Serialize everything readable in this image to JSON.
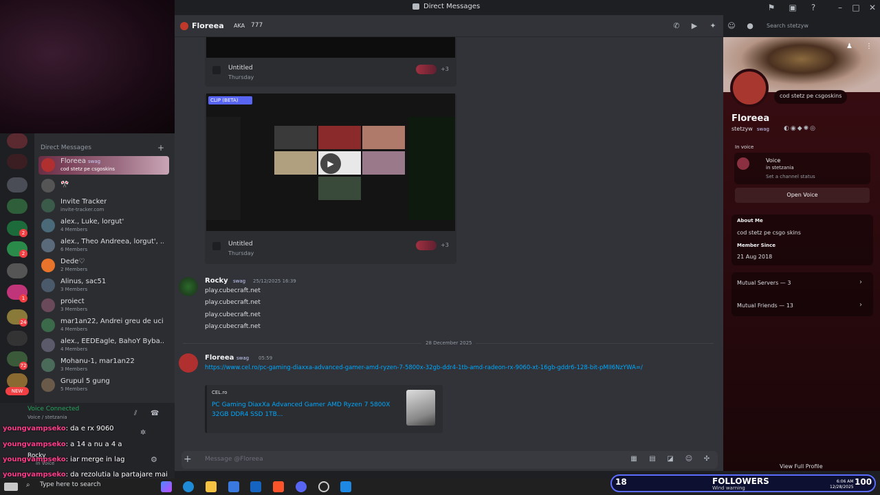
{
  "window": {
    "title": "Direct Messages"
  },
  "header": {
    "name": "Floreea",
    "aka_label": "AKA",
    "aka_value": "777",
    "search_placeholder": "Search stetzyw"
  },
  "sidebar": {
    "section_title": "Direct Messages",
    "dms": [
      {
        "name": "Floreea",
        "tag": "swag",
        "sub": "cod stetz pe csgoskins"
      },
      {
        "name": "🎌",
        "tag": "",
        "sub": ""
      },
      {
        "name": "Invite Tracker",
        "tag": "",
        "sub": "invite-tracker.com"
      },
      {
        "name": "alex., Luke, lorgut'",
        "tag": "",
        "sub": "4 Members"
      },
      {
        "name": "alex., Theo Andreea, lorgut', ...",
        "tag": "",
        "sub": "6 Members"
      },
      {
        "name": "Dede♡",
        "tag": "",
        "sub": "2 Members"
      },
      {
        "name": "Alinus, sac51",
        "tag": "",
        "sub": "3 Members"
      },
      {
        "name": "proiect",
        "tag": "",
        "sub": "3 Members"
      },
      {
        "name": "mar1an22, Andrei greu de uci...",
        "tag": "",
        "sub": "4 Members"
      },
      {
        "name": "alex., EEDEagle, BahoY Byba...",
        "tag": "",
        "sub": "4 Members"
      },
      {
        "name": "Mohanu-1, mar1an22",
        "tag": "",
        "sub": "3 Members"
      },
      {
        "name": "Grupul 5 gung",
        "tag": "",
        "sub": "5 Members"
      }
    ],
    "new_badge": "NEW",
    "server_badges": [
      "2",
      "2",
      "1",
      "24",
      "72"
    ]
  },
  "voice": {
    "status": "Voice Connected",
    "channel": "Voice / stetzania"
  },
  "stream_overlay": [
    {
      "user": "youngvampseko",
      "text": ": da e rx 9060"
    },
    {
      "user": "youngvampseko",
      "text": ": a 14 a nu a 4 a"
    },
    {
      "user": "youngvampseko",
      "text": ": iar merge in lag"
    },
    {
      "user": "youngvampseko",
      "text": ": da rezolutia la partajare mai"
    }
  ],
  "user_panel": {
    "name": "Rocky",
    "status": "In Voice"
  },
  "messages": {
    "clip1": {
      "title": "Untitled",
      "day": "Thursday",
      "count": "+3"
    },
    "clip2": {
      "badge": "CLIP (BETA)",
      "title": "Untitled",
      "day": "Thursday",
      "count": "+3"
    },
    "rocky": {
      "name": "Rocky",
      "tag": "swag",
      "time": "25/12/2025 16:39",
      "lines": [
        "play.cubecraft.net",
        "play.cubecraft.net",
        "play.cubecraft.net",
        "play.cubecraft.net"
      ]
    },
    "date_divider": "28 December 2025",
    "floreea": {
      "name": "Floreea",
      "tag": "swag",
      "time": "05:59",
      "link": "https://www.cel.ro/pc-gaming-diaxxa-advanced-gamer-amd-ryzen-7-5800x-32gb-ddr4-1tb-amd-radeon-rx-9060-xt-16gb-gddr6-128-bit-pMII6NzYWA=/",
      "embed_site": "CEL.ro",
      "embed_title": "PC Gaming DiaxXa Advanced Gamer AMD Ryzen 7 5800X 32GB DDR4 SSD 1TB..."
    }
  },
  "composer": {
    "placeholder": "Message @Floreea"
  },
  "profile": {
    "display_name": "Floreea",
    "username": "stetzyw",
    "tag": "swag",
    "status_bubble": "cod stetz pe csgoskins",
    "in_voice_label": "In voice",
    "voice_name": "Voice",
    "voice_in": "in stetzania",
    "voice_status": "Set a channel status",
    "open_voice": "Open Voice",
    "about_label": "About Me",
    "about_text": "cod stetz pe csgo skins",
    "member_since_label": "Member Since",
    "member_since": "21 Aug 2018",
    "mutual_servers": "Mutual Servers — 3",
    "mutual_friends": "Mutual Friends — 13",
    "view_full": "View Full Profile"
  },
  "taskbar": {
    "search": "Type here to search",
    "clock_time": "6:06 AM",
    "clock_date": "12/28/2025",
    "weather": "Wind warning"
  },
  "followers": {
    "left": "18",
    "label": "FOLLOWERS",
    "right": "100"
  }
}
